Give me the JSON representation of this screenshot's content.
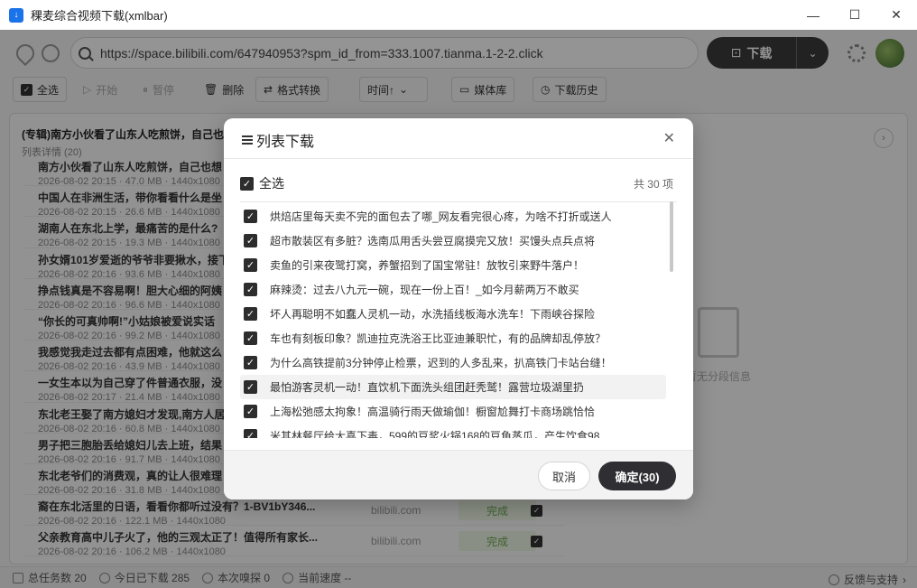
{
  "window": {
    "title": "稞麦综合视频下载(xmlbar)"
  },
  "toolbar": {
    "url": "https://space.bilibili.com/647940953?spm_id_from=333.1007.tianma.1-2-2.click",
    "download_label": "下载",
    "select_all": "全选",
    "start": "开始",
    "pause": "暂停",
    "delete": "删除",
    "convert": "格式转换",
    "sort_time": "时间↑",
    "media_lib": "媒体库",
    "history": "下载历史"
  },
  "background": {
    "group_title": "(专辑)南方小伙看了山东人吃煎饼，自己也",
    "group_sub": "列表详情 (20)",
    "rows": [
      {
        "title": "南方小伙看了山东人吃煎饼，自己也想",
        "meta": "2026-08-02 20:15 · 47.0 MB · 1440x1080"
      },
      {
        "title": "中国人在非洲生活，带你看看什么是坐",
        "meta": "2026-08-02 20:15 · 26.6 MB · 1440x1080"
      },
      {
        "title": "湖南人在东北上学，最痛苦的是什么?",
        "meta": "2026-08-02 20:15 · 19.3 MB · 1440x1080"
      },
      {
        "title": "孙女婿101岁爱逝的爷爷非要揪水，接下",
        "meta": "2026-08-02 20:16 · 93.6 MB · 1440x1080"
      },
      {
        "title": "挣点钱真是不容易啊！胆大心细的阿姨",
        "meta": "2026-08-02 20:16 · 96.6 MB · 1440x1080"
      },
      {
        "title": "“你长的可真帅啊!”小姑娘被爱说实话",
        "meta": "2026-08-02 20:16 · 99.2 MB · 1440x1080"
      },
      {
        "title": "我感觉我走过去都有点困难，他就这么",
        "meta": "2026-08-02 20:16 · 43.9 MB · 1440x1080"
      },
      {
        "title": "一女生本以为自己穿了件普通衣服，没",
        "meta": "2026-08-02 20:17 · 21.4 MB · 1440x1080"
      },
      {
        "title": "东北老王娶了南方媳妇才发现,南方人居",
        "meta": "2026-08-02 20:16 · 60.8 MB · 1440x1080"
      },
      {
        "title": "男子把三胞胎丢给媳妇儿去上班，结果",
        "meta": "2026-08-02 20:16 · 91.7 MB · 1440x1080"
      },
      {
        "title": "东北老爷们的消费观，真的让人很难理",
        "meta": "2026-08-02 20:16 · 31.8 MB · 1440x1080"
      },
      {
        "title": "裔在东北活里的日语，看看你都听过没有？1-BV1bY346...",
        "meta": "2026-08-02 20:16 · 122.1 MB · 1440x1080",
        "site": "bilibili.com",
        "status": "完成"
      },
      {
        "title": "父亲教育高中儿子火了，他的三观太正了！值得所有家长...",
        "meta": "2026-08-02 20:16 · 106.2 MB · 1440x1080",
        "site": "bilibili.com",
        "status": "完成"
      }
    ],
    "empty_text": "暂无分段信息"
  },
  "status": {
    "total": "总任务数 20",
    "today": "今日已下载 285",
    "sniff": "本次嗅探 0",
    "speed": "当前速度 --",
    "feedback": "反馈与支持"
  },
  "dialog": {
    "title": "列表下载",
    "select_all": "全选",
    "count": "共 30 项",
    "items": [
      "烘焙店里每天卖不完的面包去了哪_网友看完很心疼，为啥不打折或送人",
      "超市散装区有多脏？选南瓜用舌头尝豆腐摸完又放！买馒头点兵点将",
      "卖鱼的引来夜鹭打窝，养蟹招到了国宝常驻！放牧引来野牛落户！",
      "麻辣烫：过去八九元一碗，现在一份上百！_如今月薪两万不敢买",
      "坏人再聪明不如蠢人灵机一动，水洗插线板海水洗车！下雨峡谷探险",
      "车也有刻板印象？凯迪拉克洗浴王比亚迪兼职忙，有的品牌却乱停放？",
      "为什么高铁提前3分钟停止检票，迟到的人多乱来，扒高铁门卡站台缝！",
      "最怕游客灵机一动！直饮机下面洗头组团赶秃鹫！露营垃圾湖里扔",
      "上海松弛感太拘象！高温骑行雨天做瑜伽！橱窗尬舞打卡商场跳恰恰",
      "米其林餐厅给大喜下毒，599的豆浆火锅168的豆鱼蒸瓜，产生饮食98"
    ],
    "cancel": "取消",
    "confirm": "确定(30)"
  }
}
